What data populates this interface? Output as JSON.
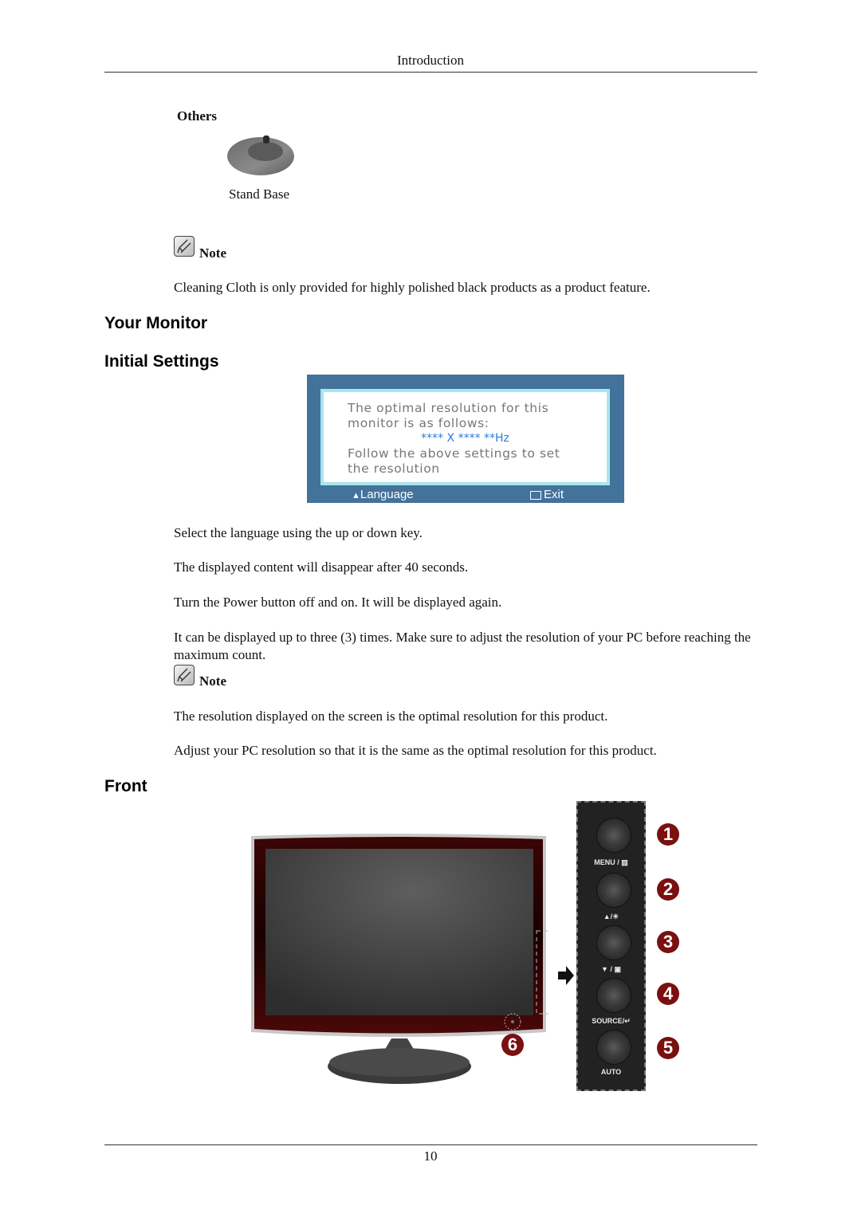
{
  "header": {
    "title": "Introduction"
  },
  "others": {
    "heading": "Others",
    "items": [
      {
        "label": "Stand Base",
        "icon": "stand-base-image"
      }
    ]
  },
  "note1": {
    "label": "Note",
    "icon": "note-pencil-icon",
    "text": "Cleaning Cloth is only provided for highly polished black products as a product feature."
  },
  "section_your_monitor": "Your Monitor",
  "section_initial_settings": "Initial Settings",
  "osd": {
    "line1": "The optimal resolution for this",
    "line2": "monitor is as follows:",
    "resolution": "**** X **** **Hz",
    "line3": "Follow the above settings to set",
    "line4": "the resolution",
    "footer_left": "Language",
    "footer_left_icon": "up-down-icon",
    "footer_right": "Exit",
    "footer_right_icon": "menu-icon",
    "colors": {
      "frame": "#43729a",
      "border": "#a8e6ee",
      "resolution": "#2b7ae0"
    }
  },
  "paragraphs": [
    "Select the language using the up or down key.",
    "The displayed content will disappear after 40 seconds.",
    "Turn the Power button off and on. It will be displayed again.",
    "It can be displayed up to three (3) times. Make sure to adjust the resolution of your PC before reaching the maximum count."
  ],
  "note2": {
    "label": "Note",
    "icon": "note-pencil-icon",
    "paragraphs": [
      "The resolution displayed on the screen is the optimal resolution for this product.",
      "Adjust your PC resolution so that it is the same as the optimal resolution for this product."
    ]
  },
  "section_front": "Front",
  "front_panel": {
    "buttons": [
      {
        "number": "1",
        "label": "MENU / ▥"
      },
      {
        "number": "2",
        "label": "▲/☀"
      },
      {
        "number": "3",
        "label": "▼ / ▣"
      },
      {
        "number": "4",
        "label": "SOURCE/↵"
      },
      {
        "number": "5",
        "label": "AUTO"
      }
    ],
    "power_number": "6",
    "badge_color": "#7a1010"
  },
  "footer": {
    "page_number": "10"
  }
}
